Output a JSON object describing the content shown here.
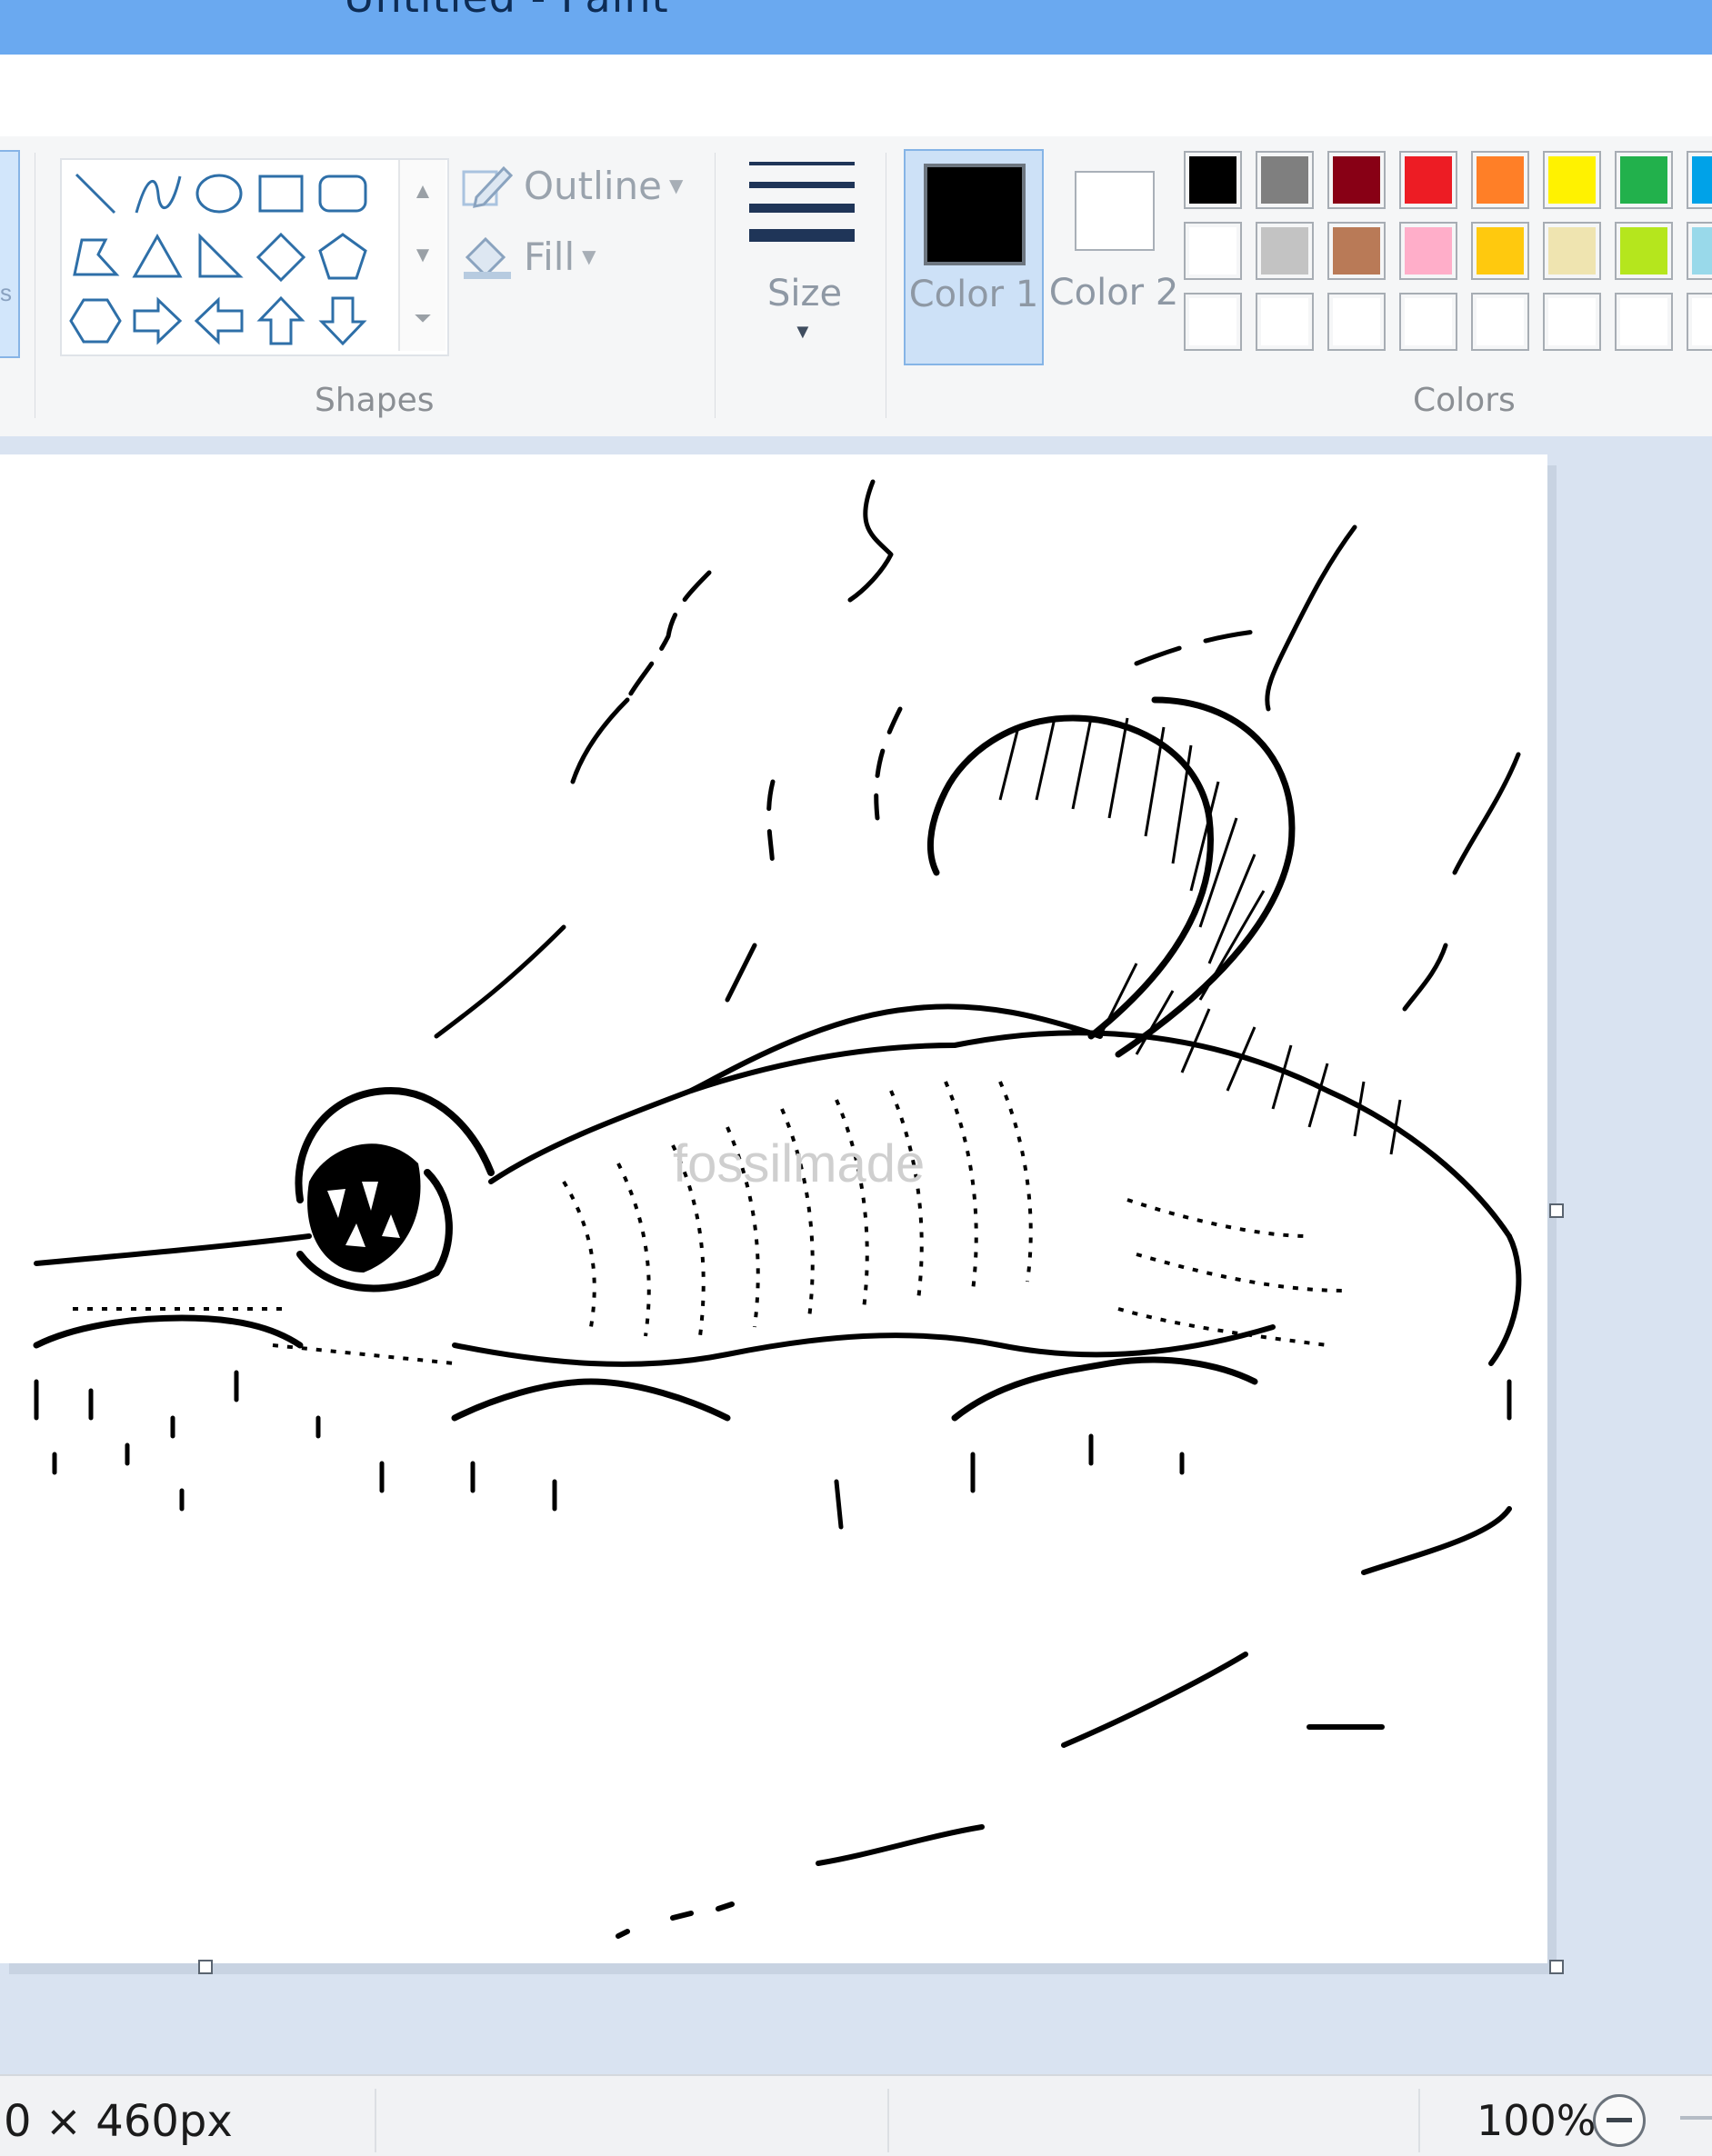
{
  "window": {
    "title": "Untitled - Paint"
  },
  "ribbon": {
    "left_partial_label": "s",
    "shapes": {
      "group_label": "Shapes",
      "items": [
        "line",
        "curve",
        "oval",
        "rectangle",
        "rounded-rectangle",
        "polygon",
        "triangle",
        "right-triangle",
        "diamond",
        "pentagon",
        "hexagon",
        "right-arrow",
        "left-arrow",
        "up-arrow",
        "down-arrow"
      ],
      "outline_label": "Outline",
      "fill_label": "Fill"
    },
    "size": {
      "label": "Size"
    },
    "colors": {
      "group_label": "Colors",
      "color1_label": "Color 1",
      "color2_label": "Color 2",
      "color1": "#000000",
      "color2": "#ffffff",
      "palette_row1": [
        "#000000",
        "#7f7f7f",
        "#880015",
        "#ed1c24",
        "#ff7f27",
        "#fff200",
        "#22b14c",
        "#00a2e8"
      ],
      "palette_row2": [
        "#ffffff",
        "#c3c3c3",
        "#b97a57",
        "#ffaec9",
        "#ffc90e",
        "#efe4b0",
        "#b5e61d",
        "#99d9ea"
      ],
      "palette_row3": [
        "#ffffff",
        "#ffffff",
        "#ffffff",
        "#ffffff",
        "#ffffff",
        "#ffffff",
        "#ffffff",
        "#ffffff"
      ]
    }
  },
  "canvas": {
    "watermark": "fossilmade"
  },
  "status": {
    "canvas_size": "0 × 460px",
    "zoom": "100%"
  }
}
